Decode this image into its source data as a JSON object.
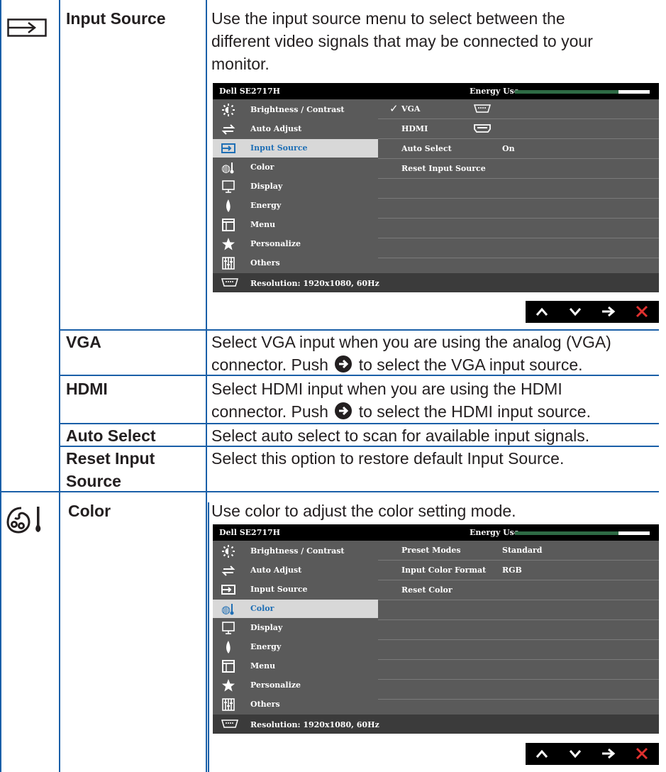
{
  "rows": {
    "input_source": {
      "label": "Input Source",
      "desc_l1": "Use the input source menu to select between the",
      "desc_l2": "different video signals that may be connected to your",
      "desc_l3": "monitor."
    },
    "vga": {
      "label": "VGA",
      "desc_l1": "Select VGA input when you are using the analog (VGA)",
      "desc_l2a": "connector. Push",
      "desc_l2b": "to select the VGA input source."
    },
    "hdmi": {
      "label": "HDMI",
      "desc_l1": "Select HDMI input when you are using the HDMI",
      "desc_l2a": "connector. Push",
      "desc_l2b": "to select the HDMI input source."
    },
    "auto_select": {
      "label": "Auto Select",
      "desc": "Select auto select to scan for available input signals."
    },
    "reset_input": {
      "label_l1": "Reset Input",
      "label_l2": "Source",
      "desc": "Select this option to restore default Input Source."
    },
    "color": {
      "label": "Color",
      "desc": "Use color to adjust the color setting mode."
    }
  },
  "osd": {
    "model": "Dell SE2717H",
    "energy_label": "Energy Use",
    "energy_level": 0.77,
    "menu_items": [
      "Brightness / Contrast",
      "Auto Adjust",
      "Input Source",
      "Color",
      "Display",
      "Energy",
      "Menu",
      "Personalize",
      "Others"
    ],
    "footer": "Resolution: 1920x1080, 60Hz",
    "input_panel": {
      "check": "✓",
      "vga": "VGA",
      "hdmi": "HDMI",
      "auto_select": "Auto Select",
      "auto_select_value": "On",
      "reset": "Reset Input Source"
    },
    "color_panel": {
      "preset_modes": "Preset Modes",
      "preset_modes_value": "Standard",
      "input_color_format": "Input Color Format",
      "input_color_format_value": "RGB",
      "reset": "Reset Color"
    }
  },
  "nav_buttons": [
    "up-icon",
    "down-icon",
    "enter-icon",
    "exit-icon"
  ],
  "colors": {
    "grid": "#1a5fa8",
    "selected_text": "#1f6fb5",
    "exit_red": "#e0312f",
    "energy_green": "#2e6b45"
  }
}
